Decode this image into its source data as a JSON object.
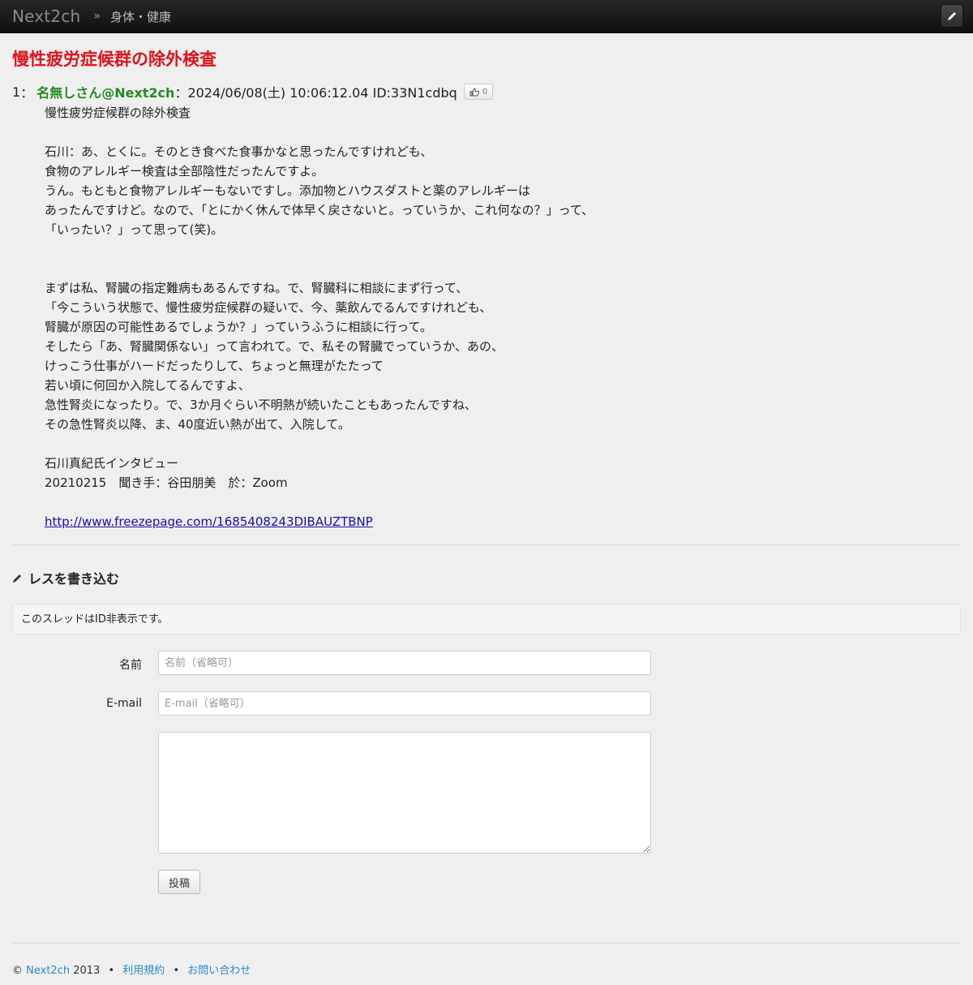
{
  "nav": {
    "brand": "Next2ch",
    "separator": "»",
    "crumb": "身体・健康"
  },
  "thread": {
    "title": "慢性疲労症候群の除外検査"
  },
  "post": {
    "number": "1",
    "colon1": "：",
    "name": "名無しさん@Next2ch",
    "meta": "：2024/06/08(土) 10:06:12.04 ID:33N1cdbq",
    "likes": "0",
    "lines": [
      "慢性疲労症候群の除外検査",
      "",
      "石川：あ、とくに。そのとき食べた食事かなと思ったんですけれども、",
      "食物のアレルギー検査は全部陰性だったんですよ。",
      "うん。もともと食物アレルギーもないですし。添加物とハウスダストと薬のアレルギーは",
      "あったんですけど。なので、「とにかく休んで体早く戻さないと。っていうか、これ何なの？」って、",
      "「いったい？」って思って(笑)。",
      "",
      "",
      "まずは私、腎臓の指定難病もあるんですね。で、腎臓科に相談にまず行って、",
      "「今こういう状態で、慢性疲労症候群の疑いで、今、薬飲んでるんですけれども、",
      "腎臓が原因の可能性あるでしょうか？」っていうふうに相談に行って。",
      "そしたら「あ、腎臓関係ない」って言われて。で、私その腎臓でっていうか、あの、",
      "けっこう仕事がハードだったりして、ちょっと無理がたたって",
      "若い頃に何回か入院してるんですよ、",
      "急性腎炎になったり。で、3か月ぐらい不明熱が続いたこともあったんですね、",
      "その急性腎炎以降、ま、40度近い熱が出て、入院して。",
      "",
      "石川真紀氏インタビュー",
      "20210215　聞き手：谷田朋美　於：Zoom",
      ""
    ],
    "link": "http://www.freezepage.com/1685408243DIBAUZTBNP"
  },
  "write": {
    "heading": "レスを書き込む",
    "notice": "このスレッドはID非表示です。",
    "name_label": "名前",
    "name_placeholder": "名前（省略可）",
    "email_label": "E-mail",
    "email_placeholder": "E-mail（省略可）",
    "submit_label": "投稿"
  },
  "footer": {
    "copyright": "©",
    "brand": "Next2ch",
    "year": "2013",
    "dot": "•",
    "terms": "利用規約",
    "contact": "お問い合わせ"
  }
}
